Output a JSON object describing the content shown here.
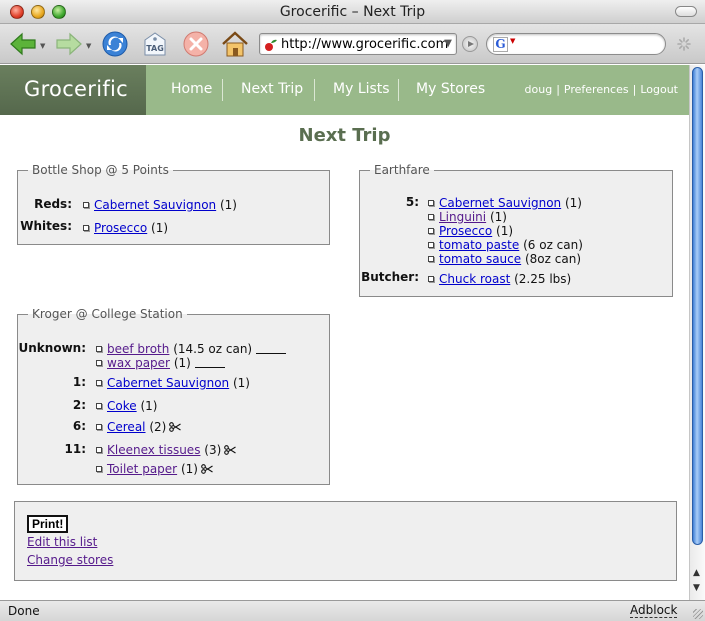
{
  "window": {
    "title": "Grocerific – Next Trip"
  },
  "browser": {
    "url": "http://www.grocerific.com",
    "status": "Done",
    "adblock": "Adblock",
    "search_engine_icon": "G"
  },
  "site": {
    "logo": "Grocerific",
    "nav": [
      "Home",
      "Next Trip",
      "My Lists",
      "My Stores"
    ],
    "user": {
      "name": "doug",
      "preferences": "Preferences",
      "logout": "Logout"
    }
  },
  "page": {
    "title": "Next Trip"
  },
  "stores": {
    "bottle_shop": {
      "name": "Bottle Shop @ 5 Points",
      "aisles": [
        {
          "label": "Reds:",
          "items": [
            {
              "name": "Cabernet Sauvignon",
              "qty": "(1)"
            }
          ]
        },
        {
          "label": "Whites:",
          "items": [
            {
              "name": "Prosecco",
              "qty": "(1)"
            }
          ]
        }
      ]
    },
    "earthfare": {
      "name": "Earthfare",
      "aisles": [
        {
          "label": "5:",
          "items": [
            {
              "name": "Cabernet Sauvignon",
              "qty": "(1)"
            },
            {
              "name": "Linguini",
              "qty": "(1)"
            },
            {
              "name": "Prosecco",
              "qty": "(1)"
            },
            {
              "name": "tomato paste",
              "qty": "(6 oz can)"
            },
            {
              "name": "tomato sauce",
              "qty": "(8oz can)"
            }
          ]
        },
        {
          "label": "Butcher:",
          "items": [
            {
              "name": "Chuck roast",
              "qty": "(2.25 lbs)"
            }
          ]
        }
      ]
    },
    "kroger": {
      "name": "Kroger @ College Station",
      "aisles": [
        {
          "label": "Unknown:",
          "items": [
            {
              "name": "beef broth",
              "qty": "(14.5 oz can)"
            },
            {
              "name": "wax paper",
              "qty": "(1)"
            }
          ]
        },
        {
          "label": "1:",
          "items": [
            {
              "name": "Cabernet Sauvignon",
              "qty": "(1)"
            }
          ]
        },
        {
          "label": "2:",
          "items": [
            {
              "name": "Coke",
              "qty": "(1)"
            }
          ]
        },
        {
          "label": "6:",
          "items": [
            {
              "name": "Cereal",
              "qty": "(2)"
            }
          ]
        },
        {
          "label": "11:",
          "items": [
            {
              "name": "Kleenex tissues",
              "qty": "(3)"
            },
            {
              "name": "Toilet paper",
              "qty": "(1)"
            }
          ]
        }
      ]
    }
  },
  "actions": {
    "print": "Print!",
    "edit": "Edit this list",
    "change_stores": "Change stores"
  },
  "icons": {
    "coupon": "scissors-icon"
  }
}
